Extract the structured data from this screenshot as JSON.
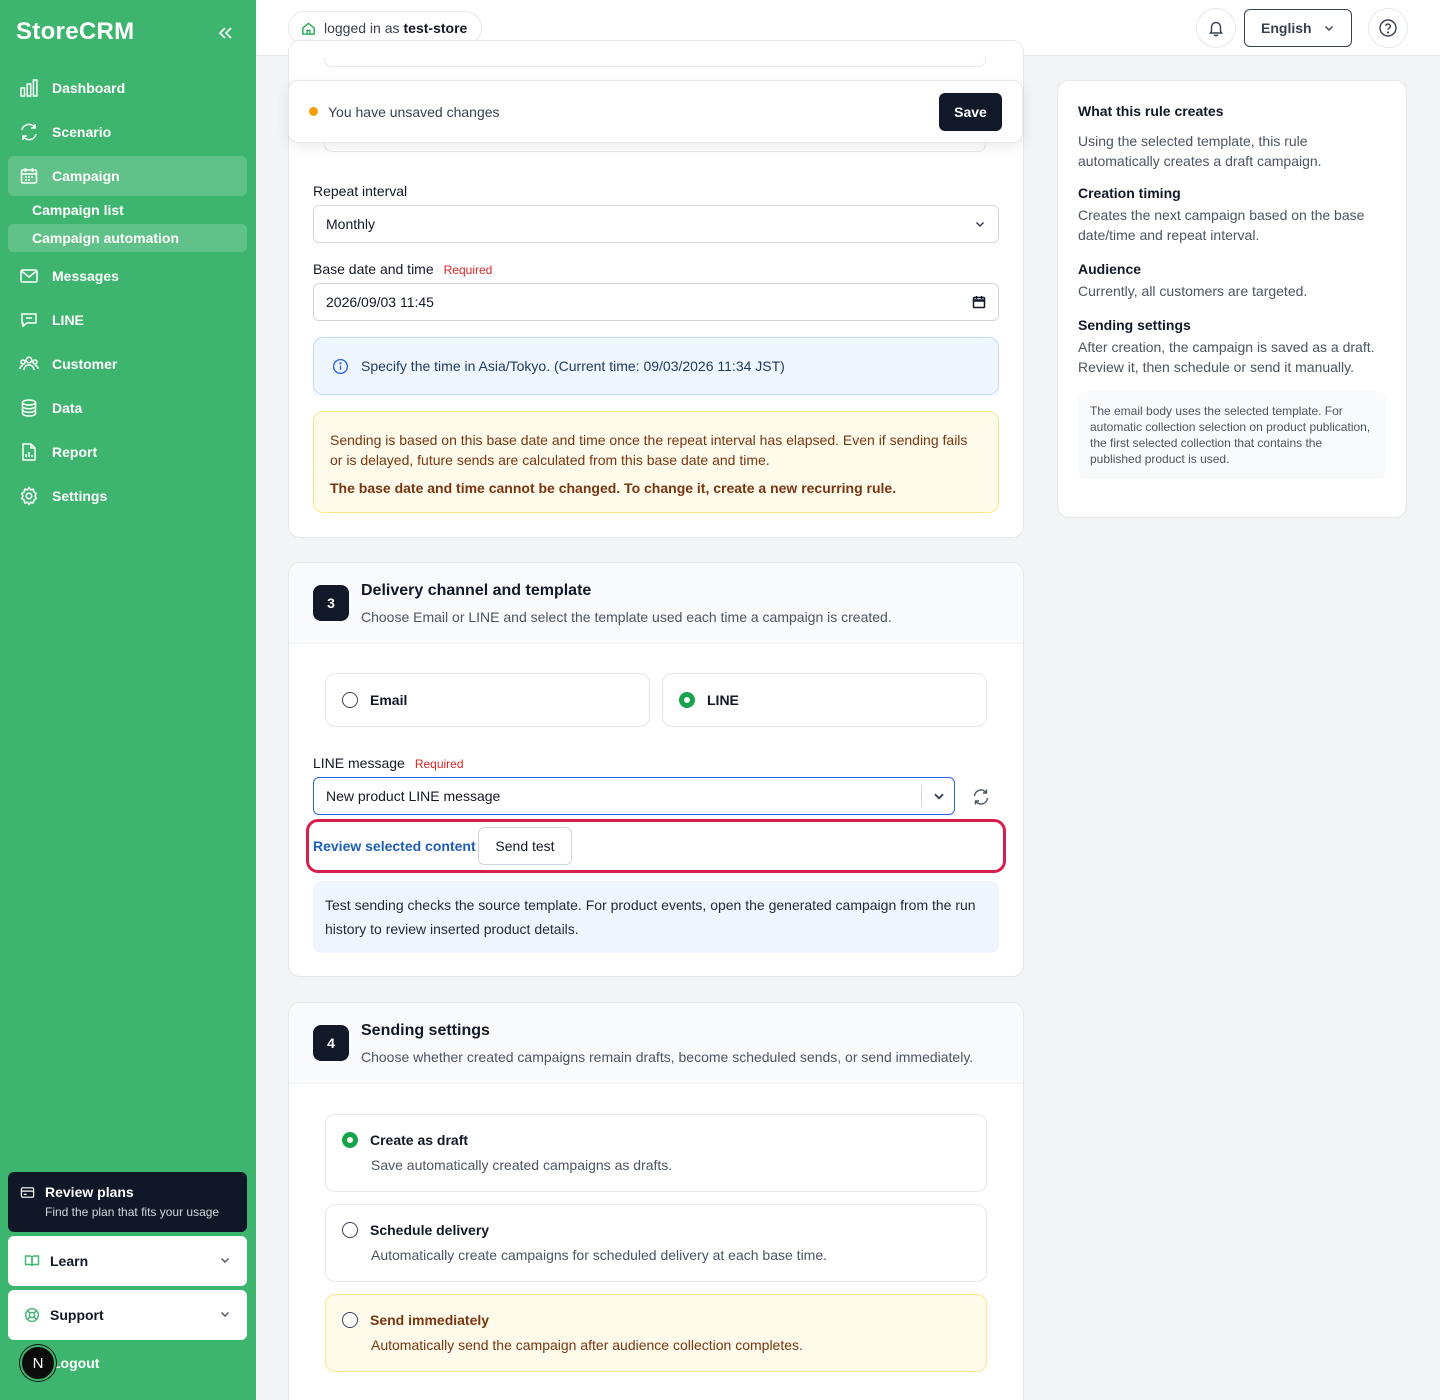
{
  "sidebar": {
    "brand": "StoreCRM",
    "items": [
      {
        "label": "Dashboard",
        "icon": "bar-chart-icon"
      },
      {
        "label": "Scenario",
        "icon": "refresh-cycle-icon"
      },
      {
        "label": "Campaign",
        "icon": "calendar-icon"
      },
      {
        "label": "Messages",
        "icon": "mail-icon"
      },
      {
        "label": "LINE",
        "icon": "chat-icon"
      },
      {
        "label": "Customer",
        "icon": "users-icon"
      },
      {
        "label": "Data",
        "icon": "database-icon"
      },
      {
        "label": "Report",
        "icon": "document-chart-icon"
      },
      {
        "label": "Settings",
        "icon": "gear-icon"
      }
    ],
    "subitems": [
      {
        "label": "Campaign list"
      },
      {
        "label": "Campaign automation"
      }
    ],
    "plan": {
      "title": "Review plans",
      "subtitle": "Find the plan that fits your usage"
    },
    "learn": "Learn",
    "support": "Support",
    "avatar_letter": "N",
    "logout": "Logout",
    "accent": "#3db56e"
  },
  "topbar": {
    "logged_in_prefix": "logged in as",
    "store": "test-store",
    "language": "English"
  },
  "unsaved": {
    "message": "You have unsaved changes",
    "save": "Save"
  },
  "schedule": {
    "repeat_label": "Repeat interval",
    "repeat_value": "Monthly",
    "base_label": "Base date and time",
    "required": "Required",
    "base_value": "2026/09/03 11:45",
    "tz_info": "Specify the time in Asia/Tokyo. (Current time: 09/03/2026 11:34 JST)",
    "warning_text": "Sending is based on this base date and time once the repeat interval has elapsed. Even if sending fails or is delayed, future sends are calculated from this base date and time.",
    "warning_strong": "The base date and time cannot be changed. To change it, create a new recurring rule."
  },
  "delivery": {
    "step": "3",
    "title": "Delivery channel and template",
    "subtitle": "Choose Email or LINE and select the template used each time a campaign is created.",
    "channel_email": "Email",
    "channel_line": "LINE",
    "selected_channel": "LINE",
    "line_message_label": "LINE message",
    "required": "Required",
    "line_message_value": "New product LINE message",
    "review_link": "Review selected content",
    "send_test": "Send test",
    "test_info": "Test sending checks the source template. For product events, open the generated campaign from the run history to review inserted product details."
  },
  "sending": {
    "step": "4",
    "title": "Sending settings",
    "subtitle": "Choose whether created campaigns remain drafts, become scheduled sends, or send immediately.",
    "options": [
      {
        "title": "Create as draft",
        "desc": "Save automatically created campaigns as drafts.",
        "selected": true
      },
      {
        "title": "Schedule delivery",
        "desc": "Automatically create campaigns for scheduled delivery at each base time.",
        "selected": false
      },
      {
        "title": "Send immediately",
        "desc": "Automatically send the campaign after audience collection completes.",
        "selected": false
      }
    ]
  },
  "side": {
    "sections": [
      {
        "title": "What this rule creates",
        "text": "Using the selected template, this rule automatically creates a draft campaign."
      },
      {
        "title": "Creation timing",
        "text": "Creates the next campaign based on the base date/time and repeat interval."
      },
      {
        "title": "Audience",
        "text": "Currently, all customers are targeted."
      },
      {
        "title": "Sending settings",
        "text": "After creation, the campaign is saved as a draft. Review it, then schedule or send it manually."
      }
    ],
    "note": "The email body uses the selected template. For automatic collection selection on product publication, the first selected collection that contains the published product is used."
  }
}
